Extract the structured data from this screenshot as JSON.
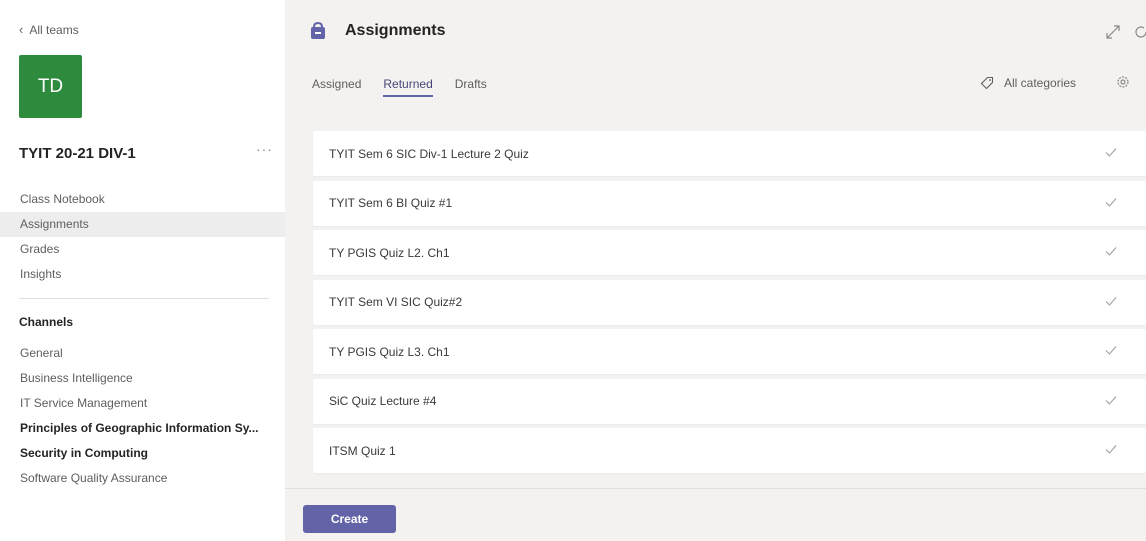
{
  "sidebar": {
    "back_label": "All teams",
    "team_initials": "TD",
    "team_color": "#2e8b3e",
    "team_name": "TYIT 20-21 DIV-1",
    "more_label": "···",
    "nav": [
      {
        "label": "Class Notebook",
        "active": false
      },
      {
        "label": "Assignments",
        "active": true
      },
      {
        "label": "Grades",
        "active": false
      },
      {
        "label": "Insights",
        "active": false
      }
    ],
    "channels_title": "Channels",
    "channels": [
      {
        "label": "General",
        "bold": false
      },
      {
        "label": "Business Intelligence",
        "bold": false
      },
      {
        "label": "IT Service Management",
        "bold": false
      },
      {
        "label": "Principles of Geographic Information Sy...",
        "bold": true
      },
      {
        "label": "Security in Computing",
        "bold": true
      },
      {
        "label": "Software Quality Assurance",
        "bold": false
      }
    ]
  },
  "header": {
    "title": "Assignments",
    "icon": "assignments-bag-icon",
    "accent": "#6264a7"
  },
  "tabs": [
    {
      "label": "Assigned",
      "active": false
    },
    {
      "label": "Returned",
      "active": true
    },
    {
      "label": "Drafts",
      "active": false
    }
  ],
  "filter": {
    "label": "All categories",
    "icon": "tag-icon"
  },
  "assignments": [
    {
      "title": "TYIT Sem 6 SIC Div-1 Lecture 2 Quiz"
    },
    {
      "title": "TYIT Sem 6 BI Quiz #1"
    },
    {
      "title": "TY PGIS Quiz L2. Ch1"
    },
    {
      "title": "TYIT Sem VI SIC Quiz#2"
    },
    {
      "title": "TY PGIS Quiz L3. Ch1"
    },
    {
      "title": "SiC Quiz Lecture #4"
    },
    {
      "title": "ITSM Quiz 1"
    }
  ],
  "footer": {
    "create_label": "Create"
  }
}
